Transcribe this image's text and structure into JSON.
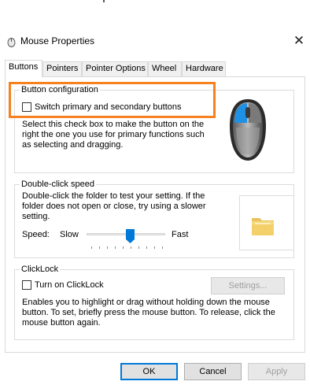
{
  "window": {
    "title": "Mouse Properties",
    "close_glyph": "✕"
  },
  "tabs": [
    {
      "label": "Buttons",
      "active": true
    },
    {
      "label": "Pointers",
      "active": false
    },
    {
      "label": "Pointer Options",
      "active": false
    },
    {
      "label": "Wheel",
      "active": false
    },
    {
      "label": "Hardware",
      "active": false
    }
  ],
  "button_config": {
    "legend": "Button configuration",
    "switch_label": "Switch primary and secondary buttons",
    "switch_checked": false,
    "description_lines": [
      "Select this check box to make the button on the",
      "right the one you use for primary functions such",
      "as selecting and dragging."
    ]
  },
  "double_click": {
    "legend": "Double-click speed",
    "description_lines": [
      "Double-click the folder to test your setting. If the",
      "folder does not open or close, try using a slower",
      "setting."
    ],
    "speed_label": "Speed:",
    "slow_label": "Slow",
    "fast_label": "Fast",
    "speed_fraction": 0.55
  },
  "clicklock": {
    "legend": "ClickLock",
    "toggle_label": "Turn on ClickLock",
    "toggle_checked": false,
    "settings_label": "Settings...",
    "description_lines": [
      "Enables you to highlight or drag without holding down the mouse",
      "button. To set, briefly press the mouse button. To release, click the",
      "mouse button again."
    ]
  },
  "buttons": {
    "ok": "OK",
    "cancel": "Cancel",
    "apply": "Apply"
  },
  "colors": {
    "highlight": "#f5821f",
    "mouse_primary": "#1e90e6",
    "accent": "#0078d7"
  }
}
